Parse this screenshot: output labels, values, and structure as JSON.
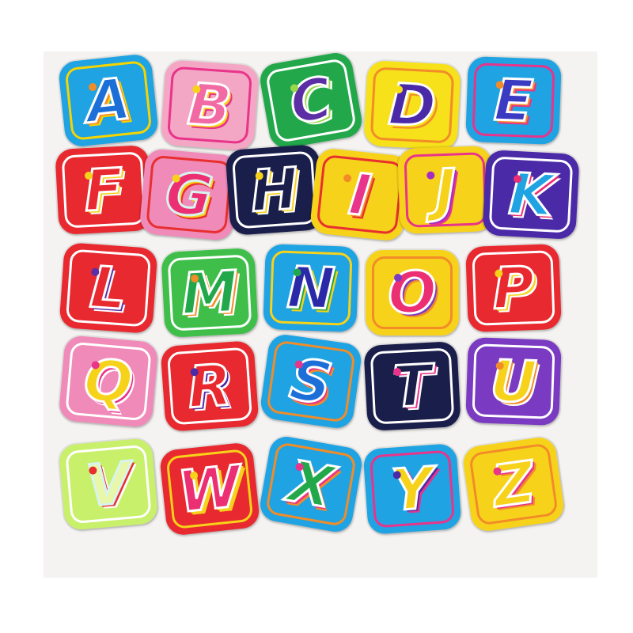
{
  "patches": [
    {
      "letter": "A",
      "edge": "#1fa3e3",
      "ring": "#f5d400",
      "fill": "#1d6fd8",
      "stroke": "#ffffff",
      "accent": "#f28c28"
    },
    {
      "letter": "B",
      "edge": "#f4a7c4",
      "ring": "#e8348a",
      "fill": "#f26aa3",
      "stroke": "#ffffff",
      "accent": "#f7d21a"
    },
    {
      "letter": "C",
      "edge": "#22a84a",
      "ring": "#ffffff",
      "fill": "#5b2ea6",
      "stroke": "#ffffff",
      "accent": "#9ad84a"
    },
    {
      "letter": "D",
      "edge": "#f7e11b",
      "ring": "#f28c28",
      "fill": "#4b2aa8",
      "stroke": "#ffffff",
      "accent": "#f7e11b"
    },
    {
      "letter": "E",
      "edge": "#1fa3e3",
      "ring": "#e8348a",
      "fill": "#3a3ac2",
      "stroke": "#ffffff",
      "accent": "#f28c28"
    },
    {
      "letter": "F",
      "edge": "#e8292f",
      "ring": "#ffffff",
      "fill": "#e8292f",
      "stroke": "#ffffff",
      "accent": "#f7d21a"
    },
    {
      "letter": "G",
      "edge": "#f08ab8",
      "ring": "#e82f2f",
      "fill": "#ec2f72",
      "stroke": "#d8f4f0",
      "accent": "#f7d21a"
    },
    {
      "letter": "H",
      "edge": "#1a1e4a",
      "ring": "#ffffff",
      "fill": "#1a1e4a",
      "stroke": "#ffffff",
      "accent": "#f7d21a"
    },
    {
      "letter": "I",
      "edge": "#f7d21a",
      "ring": "#e82f2f",
      "fill": "#e8348a",
      "stroke": "#ffffff",
      "accent": "#f28c28"
    },
    {
      "letter": "J",
      "edge": "#f7d21a",
      "ring": "#e8348a",
      "fill": "#f7d21a",
      "stroke": "#ffffff",
      "accent": "#a32cc4"
    },
    {
      "letter": "K",
      "edge": "#4b2aa8",
      "ring": "#ffffff",
      "fill": "#1fa3e3",
      "stroke": "#ffffff",
      "accent": "#ec2f72"
    },
    {
      "letter": "L",
      "edge": "#e8292f",
      "ring": "#ffffff",
      "fill": "#e8292f",
      "stroke": "#ffffff",
      "accent": "#5b2ea6"
    },
    {
      "letter": "M",
      "edge": "#3fbf4a",
      "ring": "#ffffff",
      "fill": "#22a84a",
      "stroke": "#ffffff",
      "accent": "#f28c28"
    },
    {
      "letter": "N",
      "edge": "#1fa3e3",
      "ring": "#f7d21a",
      "fill": "#2a2aa8",
      "stroke": "#ffffff",
      "accent": "#22a84a"
    },
    {
      "letter": "O",
      "edge": "#f7d21a",
      "ring": "#f28c28",
      "fill": "#ec2f72",
      "stroke": "#ffffff",
      "accent": "#7a3ac2"
    },
    {
      "letter": "P",
      "edge": "#e8292f",
      "ring": "#ffffff",
      "fill": "#e8292f",
      "stroke": "#ffffff",
      "accent": "#f7d21a"
    },
    {
      "letter": "Q",
      "edge": "#f08ab8",
      "ring": "#ffffff",
      "fill": "#f7d21a",
      "stroke": "#ffffff",
      "accent": "#e8348a"
    },
    {
      "letter": "R",
      "edge": "#e8292f",
      "ring": "#ffffff",
      "fill": "#e8292f",
      "stroke": "#ffffff",
      "accent": "#4b2aa8"
    },
    {
      "letter": "S",
      "edge": "#1fa3e3",
      "ring": "#f28c28",
      "fill": "#1d6fd8",
      "stroke": "#ffffff",
      "accent": "#e8348a"
    },
    {
      "letter": "T",
      "edge": "#1a1e4a",
      "ring": "#ffffff",
      "fill": "#1a1e4a",
      "stroke": "#ffffff",
      "accent": "#e8348a"
    },
    {
      "letter": "U",
      "edge": "#7a3ac2",
      "ring": "#ffffff",
      "fill": "#f7d21a",
      "stroke": "#ffffff",
      "accent": "#f28c28"
    },
    {
      "letter": "V",
      "edge": "#c8f06a",
      "ring": "#ffffff",
      "fill": "#e8f7a8",
      "stroke": "#d8f4f0",
      "accent": "#e82f2f"
    },
    {
      "letter": "W",
      "edge": "#e8292f",
      "ring": "#f7d21a",
      "fill": "#ec2f72",
      "stroke": "#ffffff",
      "accent": "#f7d21a"
    },
    {
      "letter": "X",
      "edge": "#1fa3e3",
      "ring": "#f28c28",
      "fill": "#22a84a",
      "stroke": "#ffffff",
      "accent": "#e8348a"
    },
    {
      "letter": "Y",
      "edge": "#1fa3e3",
      "ring": "#e8348a",
      "fill": "#f7d21a",
      "stroke": "#ffffff",
      "accent": "#4b2aa8"
    },
    {
      "letter": "Z",
      "edge": "#f7d21a",
      "ring": "#f28c28",
      "fill": "#f7d21a",
      "stroke": "#ffffff",
      "accent": "#e8348a"
    }
  ]
}
